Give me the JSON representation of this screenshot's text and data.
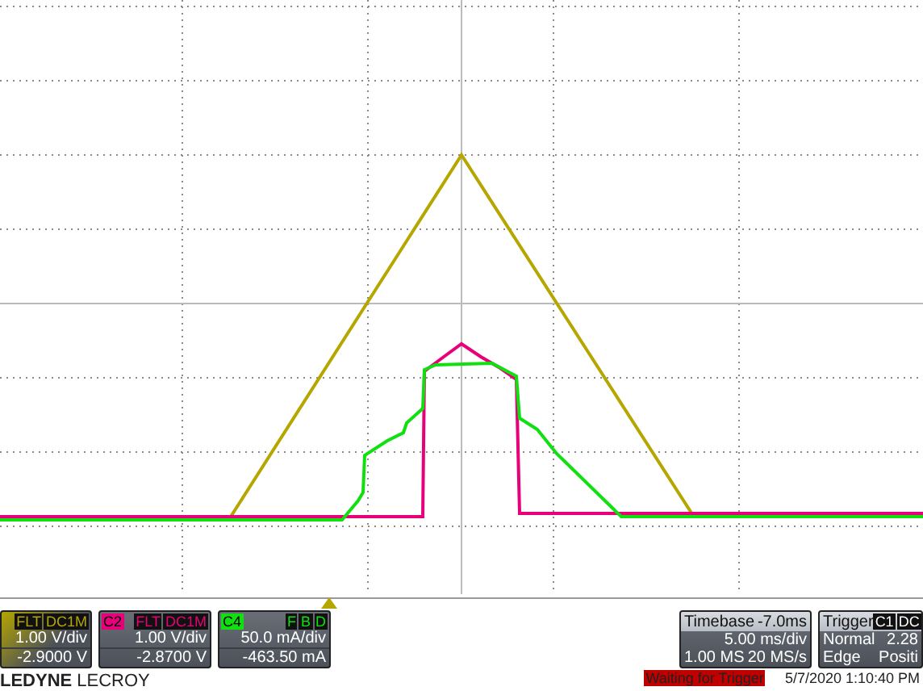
{
  "channels": [
    {
      "tags": [
        "FLT",
        "DC1M"
      ],
      "vdiv": "1.00 V/div",
      "offset": "-2.9000 V",
      "color": "#b5a600"
    },
    {
      "label": "C2",
      "tags": [
        "FLT",
        "DC1M"
      ],
      "vdiv": "1.00 V/div",
      "offset": "-2.8700 V",
      "color": "#e8007a"
    },
    {
      "label": "C4",
      "tags": [
        "F",
        "B",
        "D"
      ],
      "vdiv": "50.0 mA/div",
      "offset": "-463.50 mA",
      "color": "#10e010"
    }
  ],
  "timebase": {
    "title": "Timebase",
    "delay": "-7.0ms",
    "scale": "5.00 ms/div",
    "points": "1.00 MS",
    "rate": "20 MS/s"
  },
  "trigger": {
    "title": "Trigger",
    "tags": [
      "C1",
      "DC"
    ],
    "mode": "Normal",
    "level": "2.28",
    "type": "Edge",
    "slope": "Positi"
  },
  "logo": {
    "brand": "LEDYNE",
    "name": "LECROY"
  },
  "status": "Waiting for Trigger",
  "datetime": "5/7/2020 1:10:40 PM"
}
